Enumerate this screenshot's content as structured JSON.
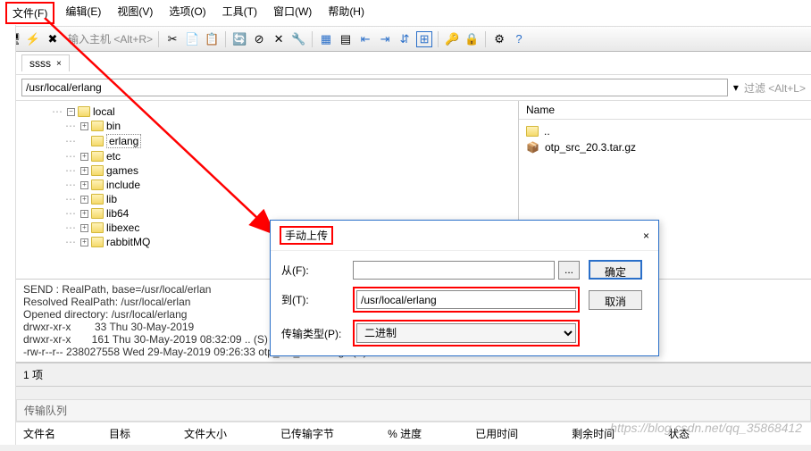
{
  "menu": {
    "file": "文件(F)",
    "edit": "编辑(E)",
    "view": "视图(V)",
    "options": "选项(O)",
    "tools": "工具(T)",
    "window": "窗口(W)",
    "help": "帮助(H)"
  },
  "toolbar": {
    "host_hint": "输入主机 <Alt+R>"
  },
  "tab": {
    "name": "ssss",
    "close": "×"
  },
  "path": {
    "value": "/usr/local/erlang",
    "filter_hint": "过滤 <Alt+L>"
  },
  "tree": {
    "root": "local",
    "items": [
      "bin",
      "erlang",
      "etc",
      "games",
      "include",
      "lib",
      "lib64",
      "libexec",
      "rabbitMQ"
    ]
  },
  "list": {
    "header_name": "Name",
    "up": "..",
    "file": "otp_src_20.3.tar.gz"
  },
  "log": {
    "l1": "SEND : RealPath, base=/usr/local/erlan",
    "l2": "Resolved RealPath: /usr/local/erlan",
    "l3": "Opened directory: /usr/local/erlang",
    "l4": "drwxr-xr-x        33 Thu 30-May-2019",
    "l5": "drwxr-xr-x       161 Thu 30-May-2019 08:32:09 .. (S)",
    "l6": "-rw-r--r-- 238027558 Wed 29-May-2019 09:26:33 otp_src_20.3.tar.gz (S)"
  },
  "status": "1 项",
  "queue_header": "传输队列",
  "cols": {
    "c1": "文件名",
    "c2": "目标",
    "c3": "文件大小",
    "c4": "已传输字节",
    "c5": "% 进度",
    "c6": "已用时间",
    "c7": "剩余时间",
    "c8": "状态"
  },
  "dialog": {
    "title": "手动上传",
    "from": "从(F):",
    "to": "到(T):",
    "to_value": "/usr/local/erlang",
    "type": "传输类型(P):",
    "type_value": "二进制",
    "ok": "确定",
    "cancel": "取消",
    "browse": "...",
    "close": "×"
  },
  "watermark": "https://blog.csdn.net/qq_35868412"
}
